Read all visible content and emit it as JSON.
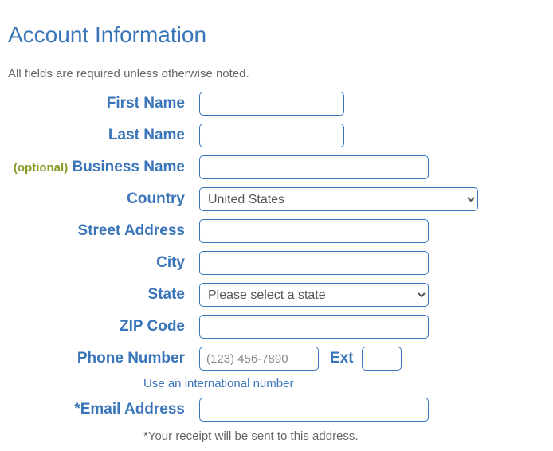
{
  "heading": "Account Information",
  "subtext": "All fields are required unless otherwise noted.",
  "fields": {
    "firstName": {
      "label": "First Name",
      "value": ""
    },
    "lastName": {
      "label": "Last Name",
      "value": ""
    },
    "businessName": {
      "optional": "(optional)",
      "label": "Business Name",
      "value": ""
    },
    "country": {
      "label": "Country",
      "selected": "United States"
    },
    "street": {
      "label": "Street Address",
      "value": ""
    },
    "city": {
      "label": "City",
      "value": ""
    },
    "state": {
      "label": "State",
      "selected": "Please select a state"
    },
    "zip": {
      "label": "ZIP Code",
      "value": ""
    },
    "phone": {
      "label": "Phone Number",
      "placeholder": "(123) 456-7890",
      "value": "",
      "extLabel": "Ext",
      "extValue": ""
    },
    "intlLink": "Use an international number",
    "email": {
      "label": "*Email Address",
      "value": ""
    },
    "footnote": "*Your receipt will be sent to this address."
  }
}
